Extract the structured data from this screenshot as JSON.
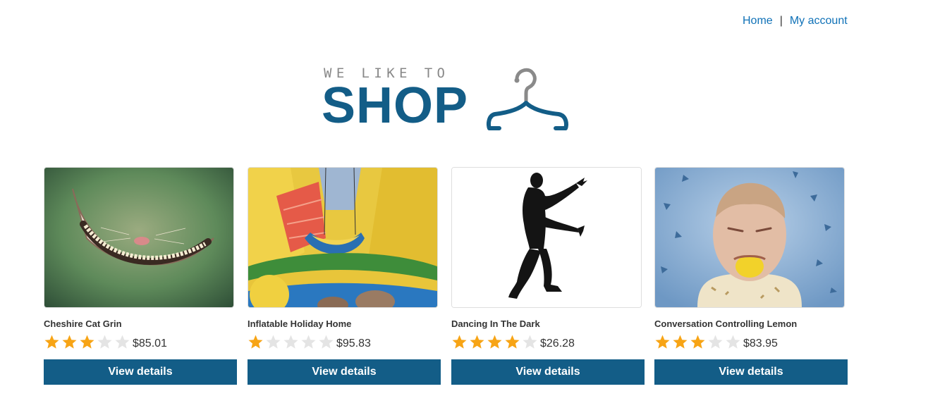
{
  "nav": {
    "home_label": "Home",
    "separator": "|",
    "account_label": "My account"
  },
  "logo": {
    "tagline": "WE LIKE TO",
    "brand": "SHOP",
    "icon": "hanger-icon"
  },
  "colors": {
    "brand": "#135d87",
    "link": "#0f71b7",
    "star_filled": "#f7a415",
    "star_empty": "#e4e4e4"
  },
  "products": [
    {
      "title": "Cheshire Cat Grin",
      "rating": 3,
      "price": "$85.01",
      "button_label": "View details"
    },
    {
      "title": "Inflatable Holiday Home",
      "rating": 1,
      "price": "$95.83",
      "button_label": "View details"
    },
    {
      "title": "Dancing In The Dark",
      "rating": 4,
      "price": "$26.28",
      "button_label": "View details"
    },
    {
      "title": "Conversation Controlling Lemon",
      "rating": 3,
      "price": "$83.95",
      "button_label": "View details"
    }
  ]
}
